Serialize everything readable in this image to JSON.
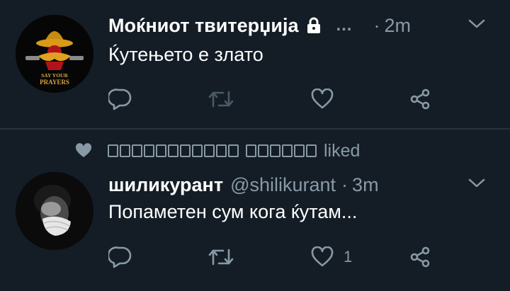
{
  "tweets": [
    {
      "display_name": "Моќниот твитерџија",
      "ellipsis": "…",
      "dot": "·",
      "time": "2m",
      "text": "Ќутењето е злато",
      "avatar_caption_1": "SAY YOUR",
      "avatar_caption_2": "PRAYERS",
      "icons": [
        "reply-icon",
        "retweet-icon",
        "like-icon",
        "share-icon",
        "lock-icon",
        "chevron-down-icon"
      ]
    },
    {
      "liked_by_word": "liked",
      "liked_by_name_glyph_count": [
        11,
        6
      ],
      "display_name": "шиликурант",
      "handle": "@shilikurant",
      "dot": "·",
      "time": "3m",
      "text": "Попаметен сум кога ќутам...",
      "like_count": "1",
      "icons": [
        "reply-icon",
        "retweet-icon",
        "like-icon",
        "share-icon",
        "heart-icon",
        "chevron-down-icon"
      ]
    }
  ],
  "colors": {
    "background": "#141d26",
    "muted": "#8899a6",
    "divider": "#26323f",
    "text": "#ffffff"
  }
}
